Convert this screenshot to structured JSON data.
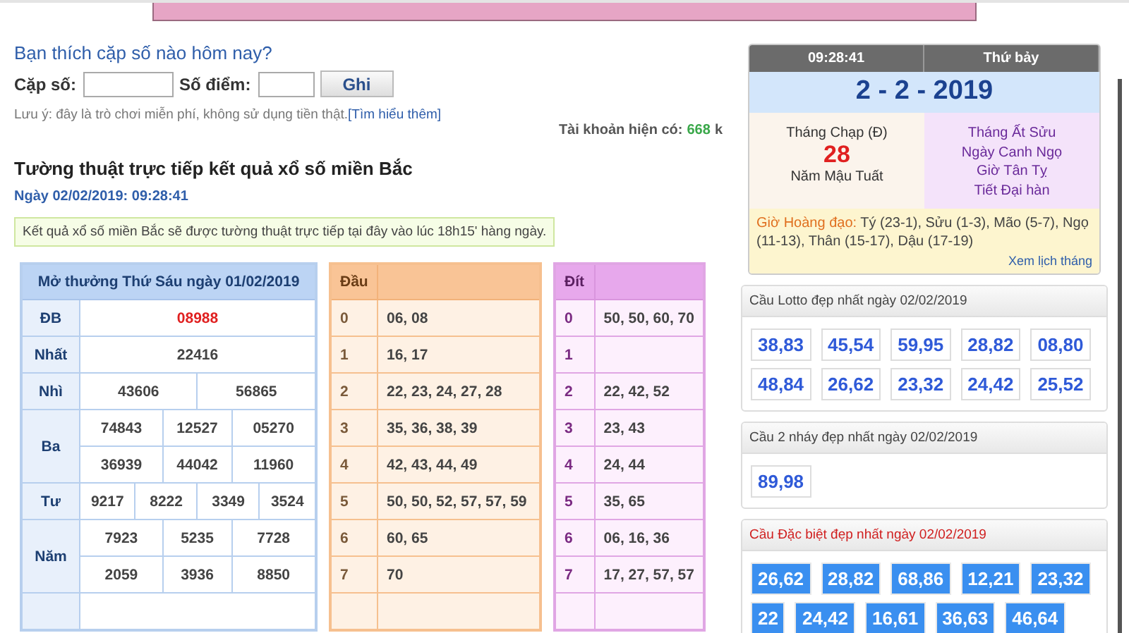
{
  "question": "Bạn thích cặp số nào hôm nay?",
  "form": {
    "pair_label": "Cặp số:",
    "points_label": "Số điểm:",
    "button": "Ghi"
  },
  "note": {
    "text": "Lưu ý: đây là trò chơi miễn phí, không sử dụng tiền thật.",
    "link": "[Tìm hiểu thêm]"
  },
  "account": {
    "label": "Tài khoản hiện có:",
    "amount": "668",
    "unit": "k"
  },
  "live": {
    "title": "Tường thuật trực tiếp kết quả xổ số miền Bắc",
    "date": "Ngày 02/02/2019: 09:28:41",
    "notice": "Kết quả xổ số miền Bắc sẽ được tường thuật trực tiếp tại đây vào lúc 18h15' hàng ngày."
  },
  "results": {
    "title": "Mở thưởng Thứ Sáu ngày 01/02/2019",
    "prizes": [
      {
        "name": "ĐB",
        "special": true,
        "rows": [
          [
            "08988"
          ]
        ]
      },
      {
        "name": "Nhất",
        "special": false,
        "rows": [
          [
            "22416"
          ]
        ]
      },
      {
        "name": "Nhì",
        "special": false,
        "rows": [
          [
            "43606",
            "56865"
          ]
        ]
      },
      {
        "name": "Ba",
        "special": false,
        "rows": [
          [
            "74843",
            "12527",
            "05270"
          ],
          [
            "36939",
            "44042",
            "11960"
          ]
        ]
      },
      {
        "name": "Tư",
        "special": false,
        "rows": [
          [
            "9217",
            "8222",
            "3349",
            "3524"
          ]
        ]
      },
      {
        "name": "Năm",
        "special": false,
        "rows": [
          [
            "7923",
            "5235",
            "7728"
          ],
          [
            "2059",
            "3936",
            "8850"
          ]
        ]
      }
    ]
  },
  "dau": {
    "header": "Đầu",
    "rows": [
      {
        "digit": "0",
        "numbers": "06, 08"
      },
      {
        "digit": "1",
        "numbers": "16, 17"
      },
      {
        "digit": "2",
        "numbers": "22, 23, 24, 27, 28"
      },
      {
        "digit": "3",
        "numbers": "35, 36, 38, 39"
      },
      {
        "digit": "4",
        "numbers": "42, 43, 44, 49"
      },
      {
        "digit": "5",
        "numbers": "50, 50, 52, 57, 57, 59"
      },
      {
        "digit": "6",
        "numbers": "60, 65"
      },
      {
        "digit": "7",
        "numbers": "70"
      }
    ]
  },
  "dit": {
    "header": "Đít",
    "rows": [
      {
        "digit": "0",
        "numbers": "50, 50, 60, 70"
      },
      {
        "digit": "1"
      },
      {
        "digit": "2",
        "numbers": "22, 42, 52"
      },
      {
        "digit": "3",
        "numbers": "23, 43"
      },
      {
        "digit": "4",
        "numbers": "24, 44"
      },
      {
        "digit": "5",
        "numbers": "35, 65"
      },
      {
        "digit": "6",
        "numbers": "06, 16, 36"
      },
      {
        "digit": "7",
        "numbers": "17, 27, 57, 57"
      }
    ]
  },
  "calendar": {
    "time": "09:28:41",
    "weekday": "Thứ bảy",
    "date": "2 - 2 - 2019",
    "lunar_month": "Tháng Chạp (Đ)",
    "lunar_day": "28",
    "lunar_year": "Năm Mậu Tuất",
    "can_chi": [
      "Tháng Ất Sửu",
      "Ngày Canh Ngọ",
      "Giờ Tân Tỵ",
      "Tiết Đại hàn"
    ],
    "good_hours_label": "Giờ Hoàng đạo:",
    "good_hours": "Tý (23-1), Sửu (1-3), Mão (5-7), Ngọ (11-13), Thân (15-17), Dậu (17-19)",
    "month_link": "Xem lịch tháng"
  },
  "panels": [
    {
      "kind": "normal",
      "title": "Cầu Lotto đẹp nhất ngày 02/02/2019",
      "numbers": [
        {
          "value": "38,83",
          "selected": false
        },
        {
          "value": "45,54",
          "selected": false
        },
        {
          "value": "59,95",
          "selected": false
        },
        {
          "value": "28,82",
          "selected": false
        },
        {
          "value": "08,80",
          "selected": false
        },
        {
          "value": "48,84",
          "selected": false
        },
        {
          "value": "26,62",
          "selected": false
        },
        {
          "value": "23,32",
          "selected": false
        },
        {
          "value": "24,42",
          "selected": false
        },
        {
          "value": "25,52",
          "selected": false
        }
      ]
    },
    {
      "kind": "normal",
      "title": "Cầu 2 nháy đẹp nhất ngày 02/02/2019",
      "numbers": [
        {
          "value": "89,98",
          "selected": false
        }
      ]
    },
    {
      "kind": "special",
      "title": "Cầu Đặc biệt đẹp nhất ngày 02/02/2019",
      "numbers": [
        {
          "value": "26,62",
          "selected": true
        },
        {
          "value": "28,82",
          "selected": true
        },
        {
          "value": "68,86",
          "selected": true
        },
        {
          "value": "12,21",
          "selected": true
        },
        {
          "value": "23,32",
          "selected": true
        },
        {
          "value": "22",
          "selected": true
        },
        {
          "value": "24,42",
          "selected": true
        },
        {
          "value": "16,61",
          "selected": true
        },
        {
          "value": "36,63",
          "selected": true
        },
        {
          "value": "46,64",
          "selected": true
        }
      ]
    }
  ]
}
